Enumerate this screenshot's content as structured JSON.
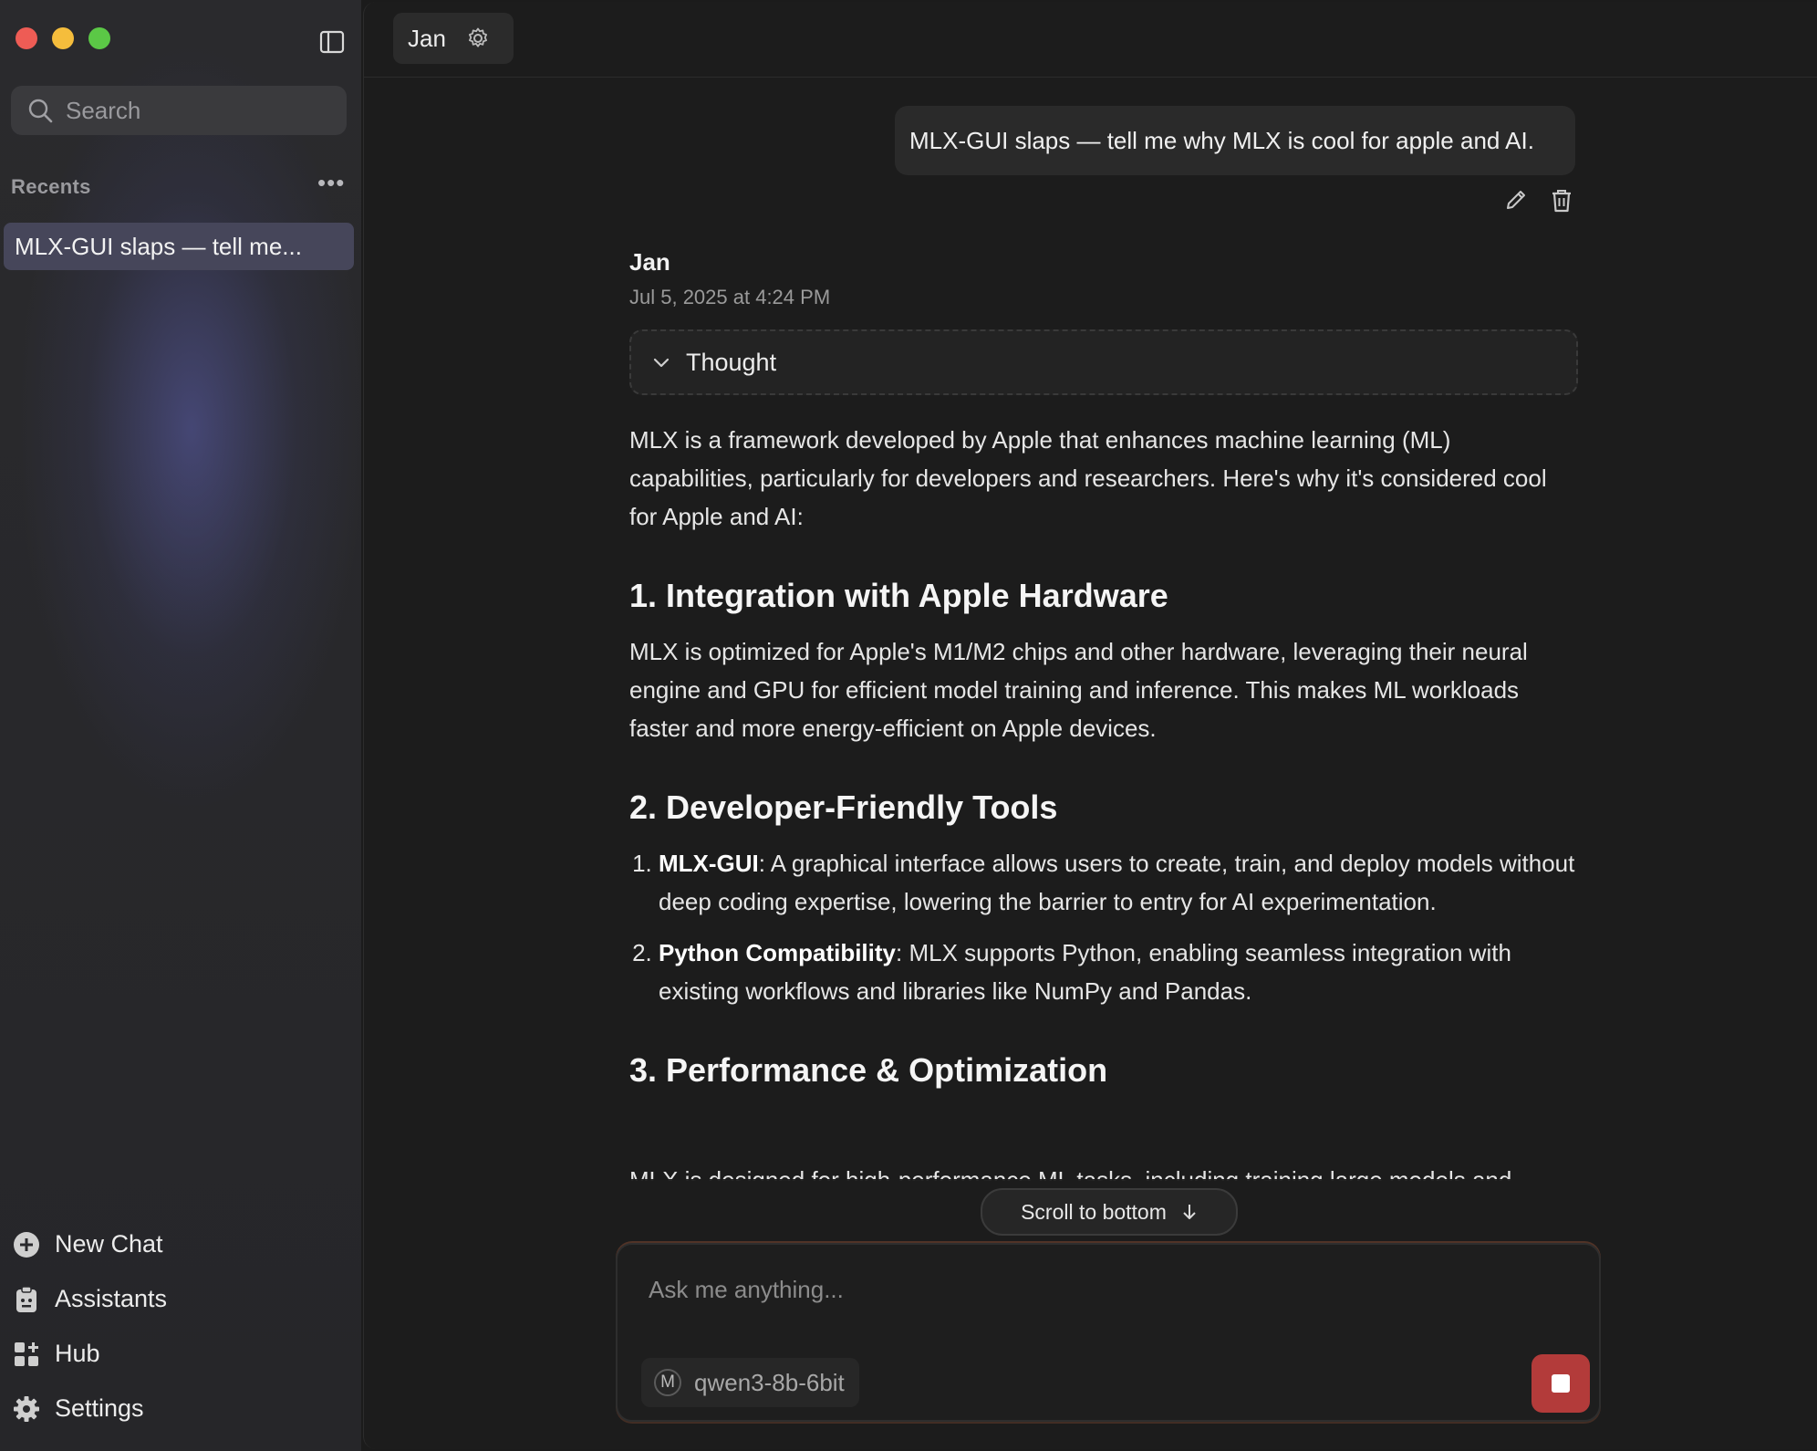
{
  "sidebar": {
    "search_placeholder": "Search",
    "recents_label": "Recents",
    "recents_more": "•••",
    "recents": [
      {
        "label": "MLX-GUI slaps — tell me..."
      }
    ],
    "nav": [
      {
        "label": "New Chat",
        "icon": "plus-circle-icon"
      },
      {
        "label": "Assistants",
        "icon": "clipboard-icon"
      },
      {
        "label": "Hub",
        "icon": "grid-plus-icon"
      },
      {
        "label": "Settings",
        "icon": "gear-icon"
      }
    ]
  },
  "header": {
    "assistant_name": "Jan"
  },
  "conversation": {
    "user_message": "MLX-GUI slaps — tell me why MLX is cool for apple and AI.",
    "reply": {
      "author": "Jan",
      "timestamp": "Jul 5, 2025 at 4:24 PM",
      "thought_label": "Thought",
      "intro": "MLX is a framework developed by Apple that enhances machine learning (ML) capabilities, particularly for developers and researchers. Here's why it's considered cool for Apple and AI:",
      "section1_title": "1. Integration with Apple Hardware",
      "section1_body": "MLX is optimized for Apple's M1/M2 chips and other hardware, leveraging their neural engine and GPU for efficient model training and inference. This makes ML workloads faster and more energy-efficient on Apple devices.",
      "section2_title": "2. Developer-Friendly Tools",
      "section2_items": [
        {
          "bold": "MLX-GUI",
          "text": ": A graphical interface allows users to create, train, and deploy models without deep coding expertise, lowering the barrier to entry for AI experimentation."
        },
        {
          "bold": "Python Compatibility",
          "text": ": MLX supports Python, enabling seamless integration with existing workflows and libraries like NumPy and Pandas."
        }
      ],
      "section3_title": "3. Performance & Optimization",
      "section3_partial": "MLX is designed for high-performance ML tasks, including training large models and"
    }
  },
  "scroll_to_bottom_label": "Scroll to bottom",
  "composer": {
    "placeholder": "Ask me anything...",
    "model_initial": "M",
    "model_name": "qwen3-8b-6bit"
  },
  "colors": {
    "accent_stop": "#b33b3a",
    "recent_selected": "#46465a"
  }
}
